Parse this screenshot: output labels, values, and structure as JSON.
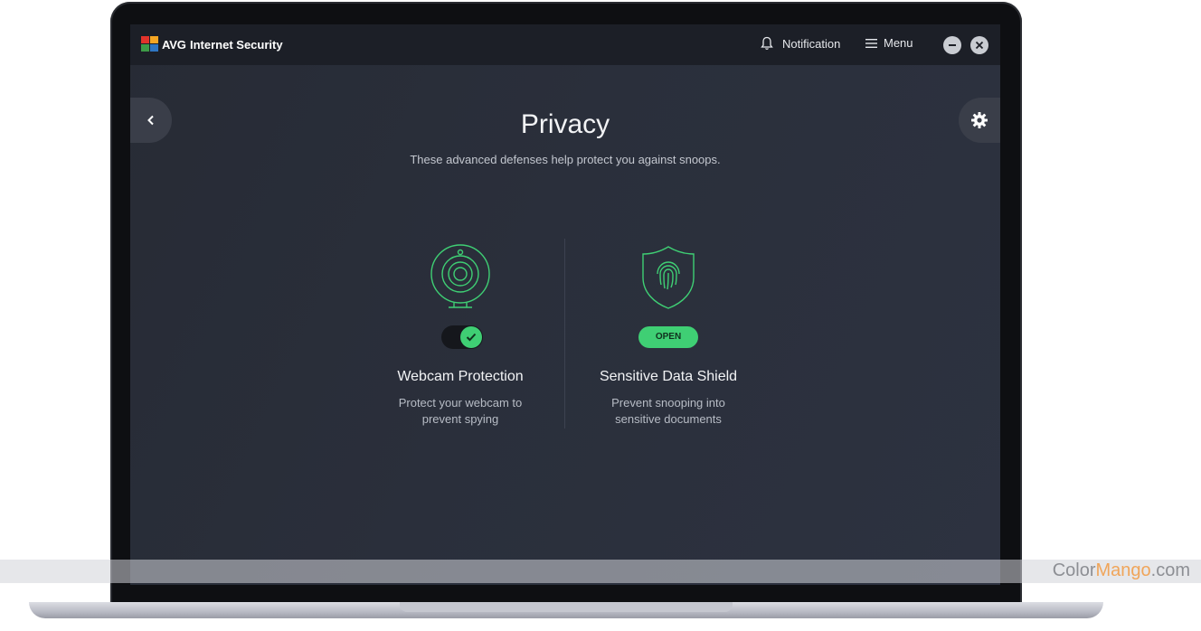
{
  "app": {
    "brand": "AVG",
    "product_name": "Internet Security"
  },
  "header": {
    "notification_label": "Notification",
    "menu_label": "Menu"
  },
  "page": {
    "title": "Privacy",
    "subtitle": "These advanced defenses help protect you against snoops."
  },
  "features": [
    {
      "title": "Webcam Protection",
      "description_line1": "Protect your webcam to",
      "description_line2": "prevent spying",
      "icon": "webcam-icon",
      "toggle_state": "on"
    },
    {
      "title": "Sensitive Data Shield",
      "description_line1": "Prevent snooping into",
      "description_line2": "sensitive documents",
      "icon": "fingerprint-shield-icon",
      "button_label": "OPEN"
    }
  ],
  "watermark": {
    "part1": "Color",
    "part2": "Mango",
    "part3": ".com"
  },
  "colors": {
    "accent_green": "#3fcf74",
    "background": "#2a2f3b",
    "titlebar": "#1c1f27"
  }
}
